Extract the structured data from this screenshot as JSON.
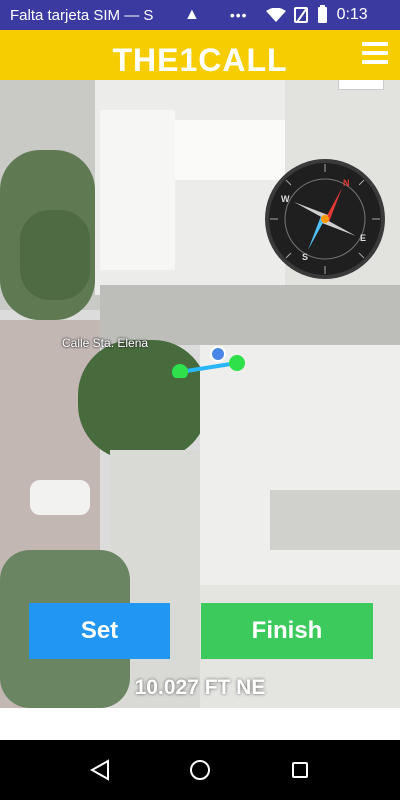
{
  "status_bar": {
    "carrier": "Falta tarjeta SIM — S",
    "overflow_dots": "•••",
    "time": "0:13",
    "icons": [
      "warning-icon",
      "wifi-icon",
      "no-sim-icon",
      "battery-icon"
    ]
  },
  "header": {
    "title": "THE1CALL",
    "background_color": "#f5cd00",
    "menu_icon": "hamburger-menu-icon"
  },
  "map": {
    "street_label": "Calle Sta. Elena",
    "compass_icon": "compass-icon"
  },
  "actions": {
    "set_label": "Set",
    "finish_label": "Finish",
    "set_color": "#2196f3",
    "finish_color": "#3dca5c"
  },
  "measurement": {
    "distance_text": "10.027 FT NE"
  },
  "nav_bar": {
    "icons": [
      "back-icon",
      "home-icon",
      "recent-apps-icon"
    ]
  }
}
